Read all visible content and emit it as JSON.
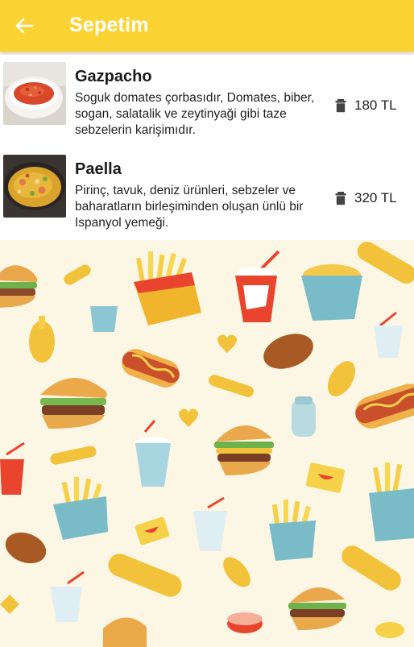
{
  "header": {
    "title": "Sepetim",
    "back_icon": "arrow-left-icon",
    "color": "#fbd433"
  },
  "cart": {
    "items": [
      {
        "name": "Gazpacho",
        "description": "Soguk domates çorbasıdır, Domates, biber, sogan, salatalik ve zeytinyaği gibi taze sebzelerin karişimıdır.",
        "price": "180 TL",
        "delete_icon": "trash-icon"
      },
      {
        "name": "Paella",
        "description": "Pirinç, tavuk, deniz ürünleri, sebzeler ve baharatların birleşiminden oluşan ünlü bir Ispanyol yemeği.",
        "price": "320 TL",
        "delete_icon": "trash-icon"
      }
    ]
  },
  "background": {
    "pattern": "fast-food-doodle-pattern",
    "color": "#fcf7e4"
  }
}
